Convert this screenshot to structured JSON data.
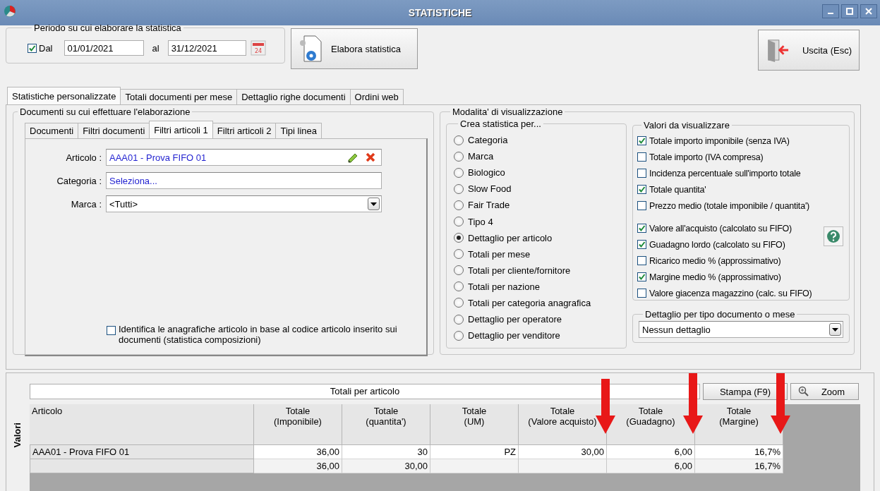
{
  "window": {
    "title": "STATISTICHE"
  },
  "period": {
    "legend": "Periodo su cui elaborare la statistica",
    "from_check": {
      "label": "Dal",
      "checked": true
    },
    "from": "01/01/2021",
    "to_label": "al",
    "to": "31/12/2021",
    "calendar_day": "24"
  },
  "process_button": "Elabora statistica",
  "exit_button": "Uscita (Esc)",
  "tabs": [
    {
      "label": "Statistiche personalizzate",
      "selected": true
    },
    {
      "label": "Totali documenti per mese",
      "selected": false
    },
    {
      "label": "Dettaglio righe documenti",
      "selected": false
    },
    {
      "label": "Ordini web",
      "selected": false
    }
  ],
  "documents_group": {
    "legend": "Documenti su cui effettuare l'elaborazione",
    "tabs": [
      {
        "label": "Documenti",
        "selected": false
      },
      {
        "label": "Filtri documenti",
        "selected": false
      },
      {
        "label": "Filtri articoli 1",
        "selected": true
      },
      {
        "label": "Filtri articoli 2",
        "selected": false
      },
      {
        "label": "Tipi linea",
        "selected": false
      }
    ],
    "fields": [
      {
        "label": "Articolo :",
        "value": "AAA01 - Prova FIFO 01",
        "kind": "lookup"
      },
      {
        "label": "Categoria :",
        "value": "Seleziona...",
        "kind": "text"
      },
      {
        "label": "Marca :",
        "value": "<Tutti>",
        "kind": "dropdown"
      }
    ],
    "compositions": {
      "label": "Identifica le anagrafiche articolo in base al codice articolo inserito sui documenti (statistica composizioni)",
      "checked": false
    }
  },
  "display_group": {
    "legend": "Modalita' di visualizzazione",
    "create_by": {
      "legend": "Crea statistica per...",
      "options": [
        {
          "label": "Categoria",
          "selected": false
        },
        {
          "label": "Marca",
          "selected": false
        },
        {
          "label": "Biologico",
          "selected": false
        },
        {
          "label": "Slow Food",
          "selected": false
        },
        {
          "label": "Fair Trade",
          "selected": false
        },
        {
          "label": "Tipo 4",
          "selected": false
        },
        {
          "label": "Dettaglio per articolo",
          "selected": true
        },
        {
          "label": "Totali per mese",
          "selected": false
        },
        {
          "label": "Totali per cliente/fornitore",
          "selected": false
        },
        {
          "label": "Totali per nazione",
          "selected": false
        },
        {
          "label": "Totali per categoria anagrafica",
          "selected": false
        },
        {
          "label": "Dettaglio per operatore",
          "selected": false
        },
        {
          "label": "Dettaglio per venditore",
          "selected": false
        }
      ]
    },
    "values": {
      "legend": "Valori da visualizzare",
      "sales": [
        {
          "label": "Totale importo imponibile (senza IVA)",
          "checked": true
        },
        {
          "label": "Totale importo (IVA compresa)",
          "checked": false
        },
        {
          "label": "Incidenza percentuale sull'importo totale",
          "checked": false
        },
        {
          "label": "Totale quantita'",
          "checked": true
        },
        {
          "label": "Prezzo medio (totale imponibile / quantita')",
          "checked": false
        }
      ],
      "cost": [
        {
          "label": "Valore all'acquisto (calcolato su FIFO)",
          "checked": true
        },
        {
          "label": "Guadagno lordo (calcolato su FIFO)",
          "checked": true
        },
        {
          "label": "Ricarico medio % (approssimativo)",
          "checked": false
        },
        {
          "label": "Margine medio % (approssimativo)",
          "checked": true
        },
        {
          "label": "Valore giacenza magazzino (calc. su FIFO)",
          "checked": false
        }
      ]
    },
    "detail": {
      "legend": "Dettaglio per tipo documento o mese",
      "value": "Nessun dettaglio"
    }
  },
  "results": {
    "side_label": "Valori",
    "title": "Totali per articolo",
    "print_button": "Stampa (F9)",
    "zoom_button": "Zoom",
    "columns": [
      "Articolo",
      "Totale\n(Imponibile)",
      "Totale\n(quantita')",
      "Totale\n(UM)",
      "Totale\n(Valore acquisto)",
      "Totale\n(Guadagno)",
      "Totale\n(Margine)"
    ],
    "rows": [
      {
        "kind": "item",
        "cells": [
          "AAA01 - Prova FIFO 01",
          "36,00",
          "30",
          "PZ",
          "30,00",
          "6,00",
          "16,7%"
        ]
      },
      {
        "kind": "total",
        "cells": [
          null,
          "36,00",
          "30,00",
          null,
          null,
          "6,00",
          "16,7%"
        ]
      }
    ]
  }
}
